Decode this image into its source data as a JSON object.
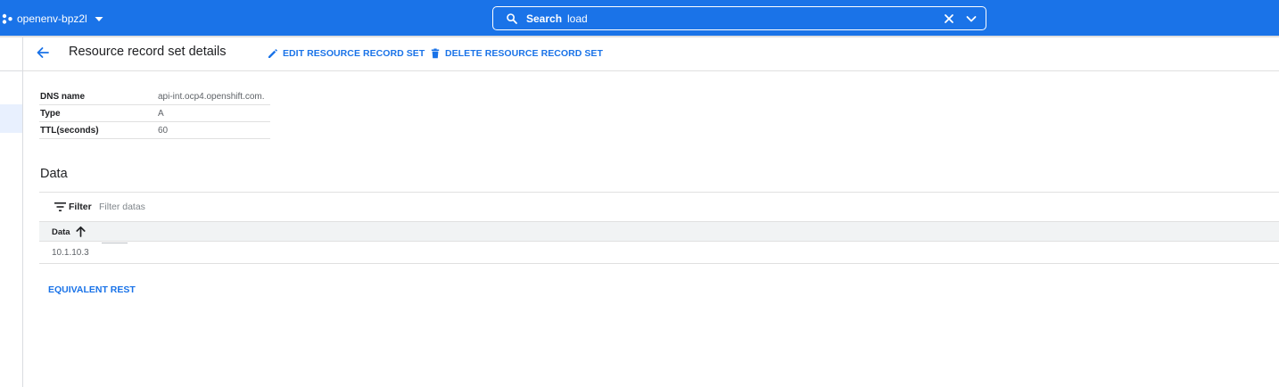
{
  "topbar": {
    "project_name": "openenv-bpz2l",
    "search_label": "Search",
    "search_value": "load",
    "accent": "#1a73e8"
  },
  "header": {
    "title": "Resource record set details",
    "edit_label": "EDIT RESOURCE RECORD SET",
    "delete_label": "DELETE RESOURCE RECORD SET"
  },
  "details": [
    {
      "key": "DNS name",
      "value": "api-int.ocp4.openshift.com."
    },
    {
      "key": "Type",
      "value": "A"
    },
    {
      "key": "TTL(seconds)",
      "value": "60"
    }
  ],
  "data_section": {
    "title": "Data",
    "filter_label": "Filter",
    "filter_placeholder": "Filter datas",
    "column_header": "Data",
    "sort": "ascending",
    "rows": [
      "10.1.10.3"
    ]
  },
  "footer": {
    "rest_link": "EQUIVALENT REST"
  },
  "icons": [
    "project-icon",
    "dropdown-caret-icon",
    "search-icon",
    "clear-icon",
    "chevron-down-icon",
    "back-arrow-icon",
    "edit-icon",
    "delete-icon",
    "filter-icon",
    "sort-ascending-icon"
  ]
}
